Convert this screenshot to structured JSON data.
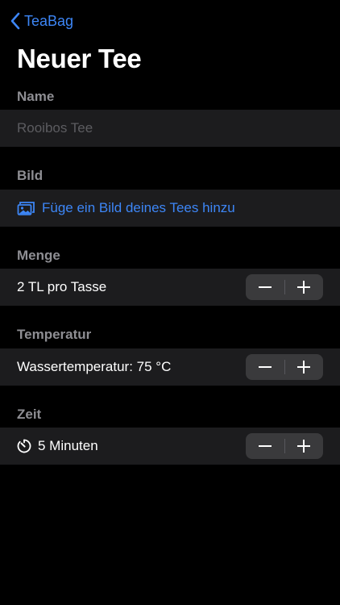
{
  "nav": {
    "back_label": "TeaBag",
    "back_icon": "chevron-left-icon",
    "accent_color": "#3d86f6"
  },
  "page": {
    "title": "Neuer Tee"
  },
  "sections": {
    "name": {
      "header": "Name",
      "placeholder": "Rooibos Tee"
    },
    "bild": {
      "header": "Bild",
      "link_label": "Füge ein Bild deines Tees hinzu",
      "icon": "photo-stack-icon"
    },
    "menge": {
      "header": "Menge",
      "value_label": "2 TL pro Tasse",
      "minus": "−",
      "plus": "+"
    },
    "temperatur": {
      "header": "Temperatur",
      "value_label": "Wassertemperatur: 75 °C",
      "minus": "−",
      "plus": "+"
    },
    "zeit": {
      "header": "Zeit",
      "value_label": "5 Minuten",
      "icon": "timer-icon",
      "minus": "−",
      "plus": "+"
    }
  }
}
